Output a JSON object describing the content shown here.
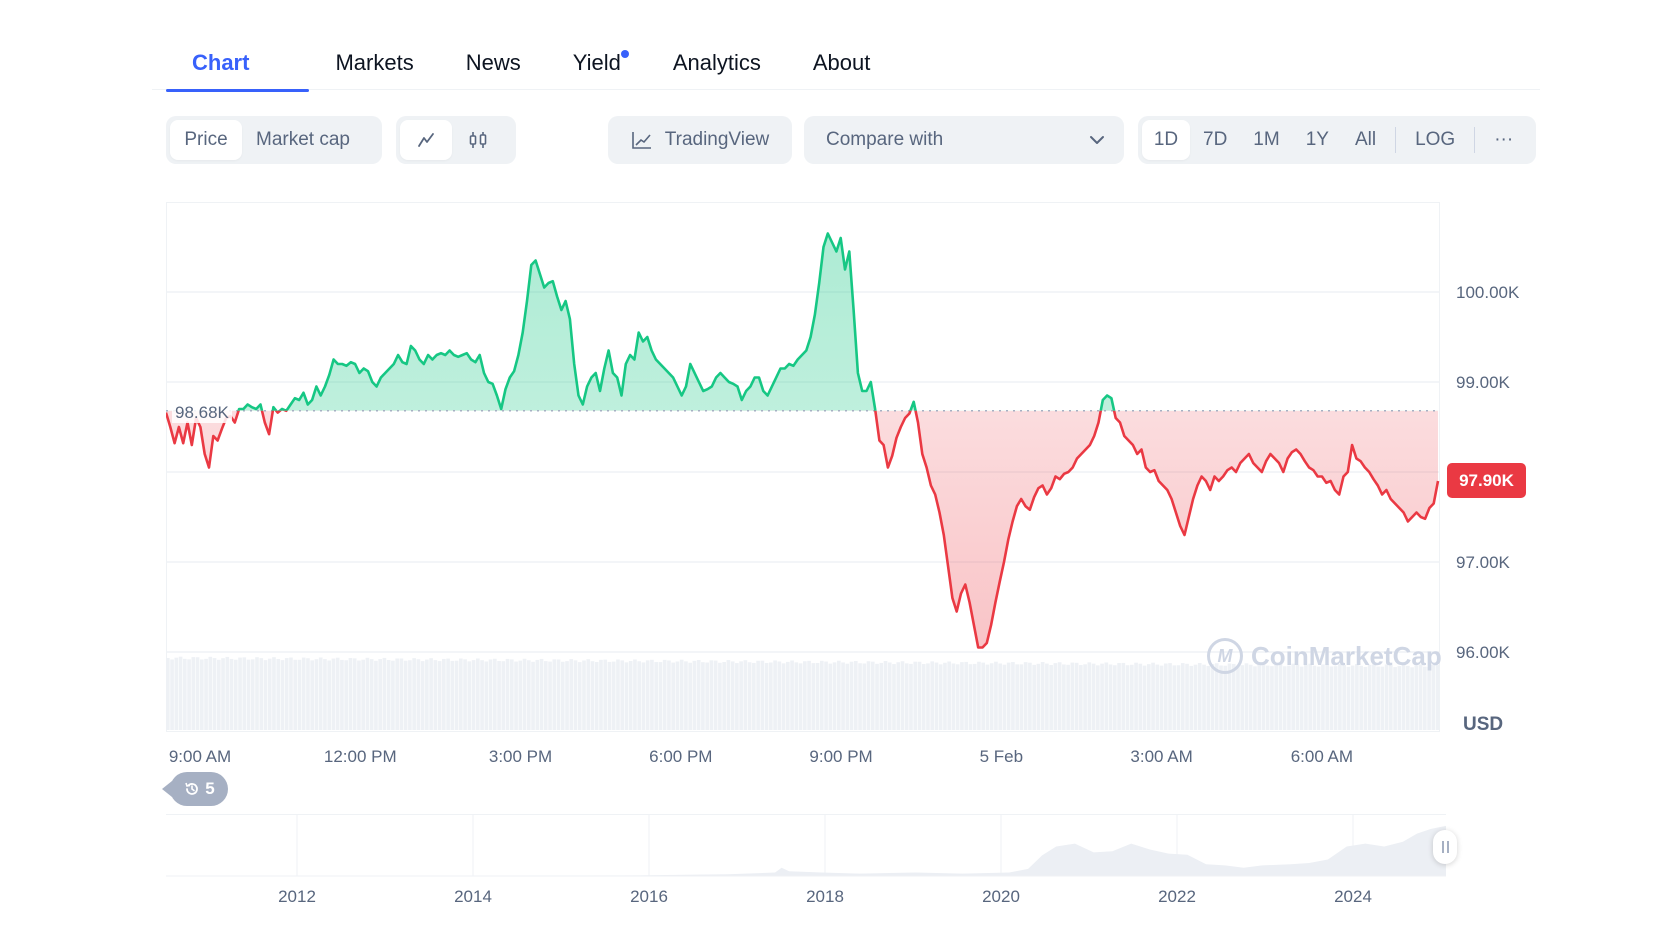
{
  "tabs": [
    {
      "label": "Chart",
      "active": true
    },
    {
      "label": "Markets"
    },
    {
      "label": "News"
    },
    {
      "label": "Yield",
      "badge_dot": true
    },
    {
      "label": "Analytics"
    },
    {
      "label": "About"
    }
  ],
  "toolbar": {
    "data_type": {
      "options": [
        "Price",
        "Market cap"
      ],
      "selected": "Price"
    },
    "chart_style": {
      "options": [
        "line-chart-icon",
        "candlestick-icon"
      ],
      "selected": "line-chart-icon"
    },
    "tradingview_label": "TradingView",
    "compare_placeholder": "Compare with",
    "ranges": [
      "1D",
      "7D",
      "1M",
      "1Y",
      "All"
    ],
    "selected_range": "1D",
    "log_label": "LOG",
    "more_label": "···"
  },
  "colors": {
    "accent": "#3861fb",
    "up": "#16c784",
    "down": "#ea3943",
    "muted": "#58667e"
  },
  "chart_data": {
    "type": "area",
    "title": "",
    "currency": "USD",
    "baseline": 98.68,
    "baseline_label": "98.68K",
    "current_price_label": "97.90K",
    "current_price": 97.9,
    "ylim": [
      95.6,
      101.0
    ],
    "y_ticks": [
      {
        "value": 100,
        "label": "100.00K"
      },
      {
        "value": 99,
        "label": "99.00K"
      },
      {
        "value": 97,
        "label": "97.00K"
      },
      {
        "value": 96,
        "label": "96.00K"
      }
    ],
    "x_ticks": [
      {
        "pos": 0.0,
        "label": "9:00 AM"
      },
      {
        "pos": 0.1258,
        "label": "12:00 PM"
      },
      {
        "pos": 0.2516,
        "label": "3:00 PM"
      },
      {
        "pos": 0.3774,
        "label": "6:00 PM"
      },
      {
        "pos": 0.5032,
        "label": "9:00 PM"
      },
      {
        "pos": 0.629,
        "label": "5 Feb"
      },
      {
        "pos": 0.7548,
        "label": "3:00 AM"
      },
      {
        "pos": 0.8806,
        "label": "6:00 AM"
      }
    ],
    "grid": true,
    "values": [
      98.66,
      98.5,
      98.32,
      98.5,
      98.32,
      98.55,
      98.3,
      98.6,
      98.5,
      98.2,
      98.05,
      98.4,
      98.35,
      98.48,
      98.6,
      98.62,
      98.55,
      98.7,
      98.7,
      98.75,
      98.72,
      98.7,
      98.75,
      98.55,
      98.42,
      98.72,
      98.66,
      98.7,
      98.68,
      98.75,
      98.82,
      98.8,
      98.88,
      98.75,
      98.8,
      98.95,
      98.85,
      98.95,
      99.08,
      99.25,
      99.2,
      99.2,
      99.18,
      99.22,
      99.2,
      99.1,
      99.15,
      99.12,
      99.0,
      98.95,
      99.05,
      99.1,
      99.15,
      99.2,
      99.3,
      99.22,
      99.2,
      99.4,
      99.35,
      99.25,
      99.2,
      99.3,
      99.25,
      99.3,
      99.32,
      99.3,
      99.35,
      99.3,
      99.28,
      99.3,
      99.32,
      99.25,
      99.22,
      99.3,
      99.1,
      99.0,
      98.98,
      98.85,
      98.7,
      98.92,
      99.05,
      99.12,
      99.3,
      99.55,
      99.9,
      100.3,
      100.35,
      100.2,
      100.05,
      100.1,
      100.12,
      99.95,
      99.8,
      99.9,
      99.7,
      99.2,
      98.85,
      98.75,
      98.95,
      99.05,
      99.1,
      98.9,
      99.15,
      99.35,
      99.1,
      99.05,
      98.85,
      99.2,
      99.3,
      99.25,
      99.55,
      99.45,
      99.5,
      99.35,
      99.25,
      99.2,
      99.15,
      99.1,
      99.05,
      98.95,
      98.85,
      98.95,
      99.2,
      99.1,
      99.0,
      98.9,
      98.92,
      98.95,
      99.05,
      99.1,
      99.05,
      99.0,
      98.98,
      98.95,
      98.8,
      98.9,
      98.95,
      99.05,
      99.05,
      98.9,
      98.85,
      98.95,
      99.05,
      99.15,
      99.15,
      99.2,
      99.18,
      99.25,
      99.3,
      99.35,
      99.5,
      99.75,
      100.1,
      100.5,
      100.65,
      100.55,
      100.45,
      100.6,
      100.25,
      100.45,
      99.8,
      99.1,
      98.9,
      98.9,
      99.0,
      98.7,
      98.35,
      98.3,
      98.05,
      98.18,
      98.38,
      98.5,
      98.6,
      98.65,
      98.78,
      98.55,
      98.2,
      98.05,
      97.85,
      97.75,
      97.55,
      97.3,
      96.95,
      96.6,
      96.45,
      96.65,
      96.75,
      96.55,
      96.3,
      96.05,
      96.05,
      96.1,
      96.3,
      96.55,
      96.78,
      97.0,
      97.25,
      97.45,
      97.62,
      97.7,
      97.62,
      97.58,
      97.72,
      97.82,
      97.85,
      97.75,
      97.82,
      97.95,
      97.92,
      97.98,
      98.0,
      98.05,
      98.15,
      98.2,
      98.25,
      98.3,
      98.4,
      98.55,
      98.8,
      98.85,
      98.82,
      98.6,
      98.55,
      98.4,
      98.35,
      98.3,
      98.2,
      98.25,
      98.05,
      98.0,
      98.02,
      97.9,
      97.85,
      97.8,
      97.7,
      97.55,
      97.4,
      97.3,
      97.5,
      97.7,
      97.85,
      97.95,
      97.9,
      97.8,
      97.95,
      97.9,
      97.95,
      98.02,
      98.05,
      98.0,
      98.1,
      98.15,
      98.2,
      98.1,
      98.05,
      98.0,
      98.12,
      98.2,
      98.15,
      98.1,
      98.0,
      98.15,
      98.22,
      98.25,
      98.2,
      98.12,
      98.05,
      98.02,
      97.95,
      97.95,
      97.88,
      97.9,
      97.8,
      97.75,
      97.95,
      98.0,
      98.3,
      98.15,
      98.12,
      98.05,
      98.0,
      97.92,
      97.85,
      97.75,
      97.8,
      97.7,
      97.65,
      97.6,
      97.55,
      97.45,
      97.5,
      97.55,
      97.5,
      97.48,
      97.6,
      97.65,
      97.9
    ],
    "volume_relative": "flat, slightly declining",
    "navigator": {
      "x_ticks": [
        "2012",
        "2014",
        "2016",
        "2018",
        "2020",
        "2022",
        "2024"
      ],
      "description": "All-time BTC price overview"
    }
  },
  "history_badge": {
    "count": "5"
  },
  "watermark": "CoinMarketCap"
}
